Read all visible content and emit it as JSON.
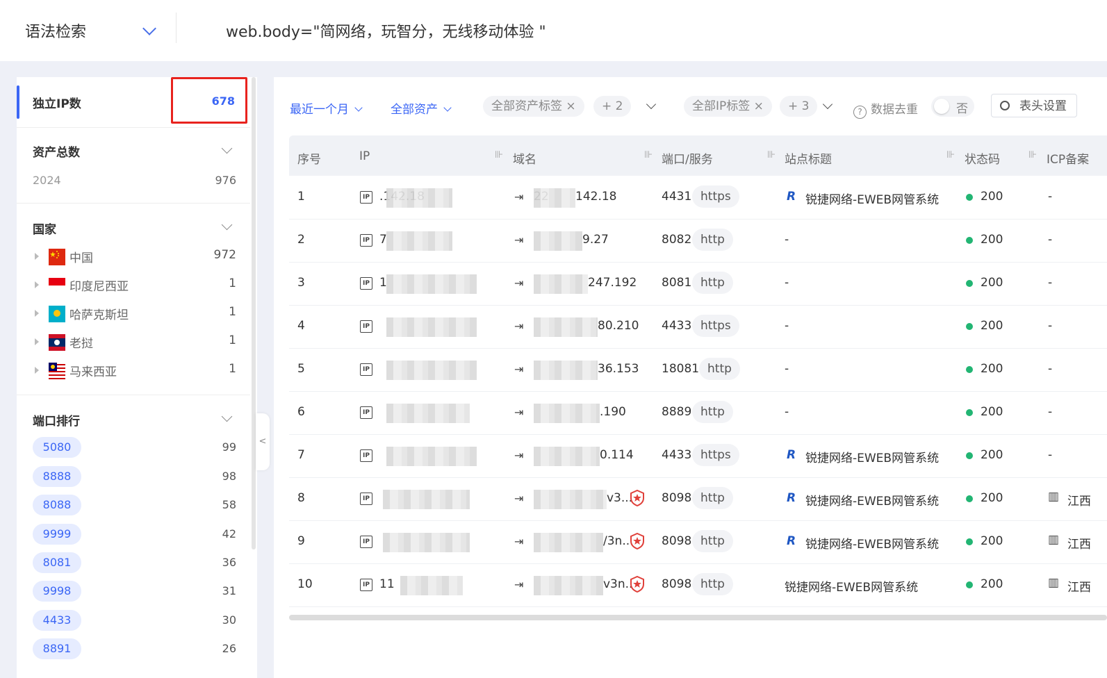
{
  "topbar": {
    "syntax_label": "语法检索",
    "query": "web.body=\"简网络，玩智分，无线移动体验 \""
  },
  "sidebar": {
    "unique_ip": {
      "label": "独立IP数",
      "value": "678"
    },
    "total_assets": {
      "label": "资产总数",
      "year": "2024",
      "count": "976"
    },
    "country": {
      "label": "国家",
      "items": [
        {
          "name": "中国",
          "count": "972",
          "flag": "cn-flag-icon"
        },
        {
          "name": "印度尼西亚",
          "count": "1",
          "flag": "id-flag-icon"
        },
        {
          "name": "哈萨克斯坦",
          "count": "1",
          "flag": "kz-flag-icon"
        },
        {
          "name": "老挝",
          "count": "1",
          "flag": "la-flag-icon"
        },
        {
          "name": "马来西亚",
          "count": "1",
          "flag": "my-flag-icon"
        }
      ]
    },
    "ports": {
      "label": "端口排行",
      "items": [
        {
          "port": "5080",
          "count": "99"
        },
        {
          "port": "8888",
          "count": "98"
        },
        {
          "port": "8088",
          "count": "58"
        },
        {
          "port": "9999",
          "count": "42"
        },
        {
          "port": "8081",
          "count": "36"
        },
        {
          "port": "9998",
          "count": "31"
        },
        {
          "port": "4433",
          "count": "30"
        },
        {
          "port": "8891",
          "count": "26"
        }
      ]
    },
    "collapse_glyph": "<"
  },
  "filters": {
    "time": "最近一个月",
    "assets": "全部资产",
    "asset_tag": "全部资产标签",
    "asset_tag_more": "+ 2",
    "ip_tag": "全部IP标签",
    "ip_tag_more": "+ 3",
    "close_glyph": "×",
    "help_glyph": "?",
    "dedupe_label": "数据去重",
    "dedupe_value": "否",
    "header_settings": "表头设置"
  },
  "table": {
    "headers": [
      "序号",
      "IP",
      "域名",
      "端口/服务",
      "站点标题",
      "状态码",
      "ICP备案"
    ],
    "resizer_glyph": "⊪",
    "ip_icon_text": "IP",
    "domain_glyph": "⇥",
    "logo_glyph": "R",
    "building_glyph": "▥",
    "rows": [
      {
        "no": "1",
        "ip": ".142.18",
        "domain": "22",
        "domain_tail": "142.18",
        "port": "4431",
        "svc": "https",
        "title": "锐捷网络-EWEB网管系统",
        "logo": true,
        "badge": false,
        "status": "200",
        "icp": "-"
      },
      {
        "no": "2",
        "ip": "7",
        "domain": "",
        "domain_tail": "9.27",
        "port": "8082",
        "svc": "http",
        "title": "-",
        "logo": false,
        "badge": false,
        "status": "200",
        "icp": "-"
      },
      {
        "no": "3",
        "ip": "1",
        "domain": "",
        "domain_tail": "247.192",
        "port": "8081",
        "svc": "http",
        "title": "-",
        "logo": false,
        "badge": false,
        "status": "200",
        "icp": "-"
      },
      {
        "no": "4",
        "ip": "",
        "domain": "",
        "domain_tail": "80.210",
        "port": "4433",
        "svc": "https",
        "title": "-",
        "logo": false,
        "badge": false,
        "status": "200",
        "icp": "-"
      },
      {
        "no": "5",
        "ip": "",
        "domain": "",
        "domain_tail": "36.153",
        "port": "18081",
        "svc": "http",
        "title": "-",
        "logo": false,
        "badge": false,
        "status": "200",
        "icp": "-"
      },
      {
        "no": "6",
        "ip": "",
        "domain": "",
        "domain_tail": ".190",
        "port": "8889",
        "svc": "http",
        "title": "-",
        "logo": false,
        "badge": false,
        "status": "200",
        "icp": "-"
      },
      {
        "no": "7",
        "ip": "",
        "domain": "",
        "domain_tail": "0.114",
        "port": "4433",
        "svc": "https",
        "title": "锐捷网络-EWEB网管系统",
        "logo": true,
        "badge": false,
        "status": "200",
        "icp": "-"
      },
      {
        "no": "8",
        "ip": "",
        "domain": "",
        "domain_tail": "v3...",
        "port": "8098",
        "svc": "http",
        "title": "锐捷网络-EWEB网管系统",
        "logo": true,
        "badge": true,
        "status": "200",
        "icp": "江西"
      },
      {
        "no": "9",
        "ip": "",
        "domain": "",
        "domain_tail": "/3n...",
        "port": "8098",
        "svc": "http",
        "title": "锐捷网络-EWEB网管系统",
        "logo": true,
        "badge": true,
        "status": "200",
        "icp": "江西"
      },
      {
        "no": "10",
        "ip": "11",
        "domain": "",
        "domain_tail": "v3n...",
        "port": "8098",
        "svc": "http",
        "title": "锐捷网络-EWEB网管系统",
        "logo": false,
        "badge": true,
        "status": "200",
        "icp": "江西"
      }
    ]
  },
  "colors": {
    "accent": "#3b66f5",
    "status_ok": "#22b573",
    "highlight": "#e8231e"
  }
}
